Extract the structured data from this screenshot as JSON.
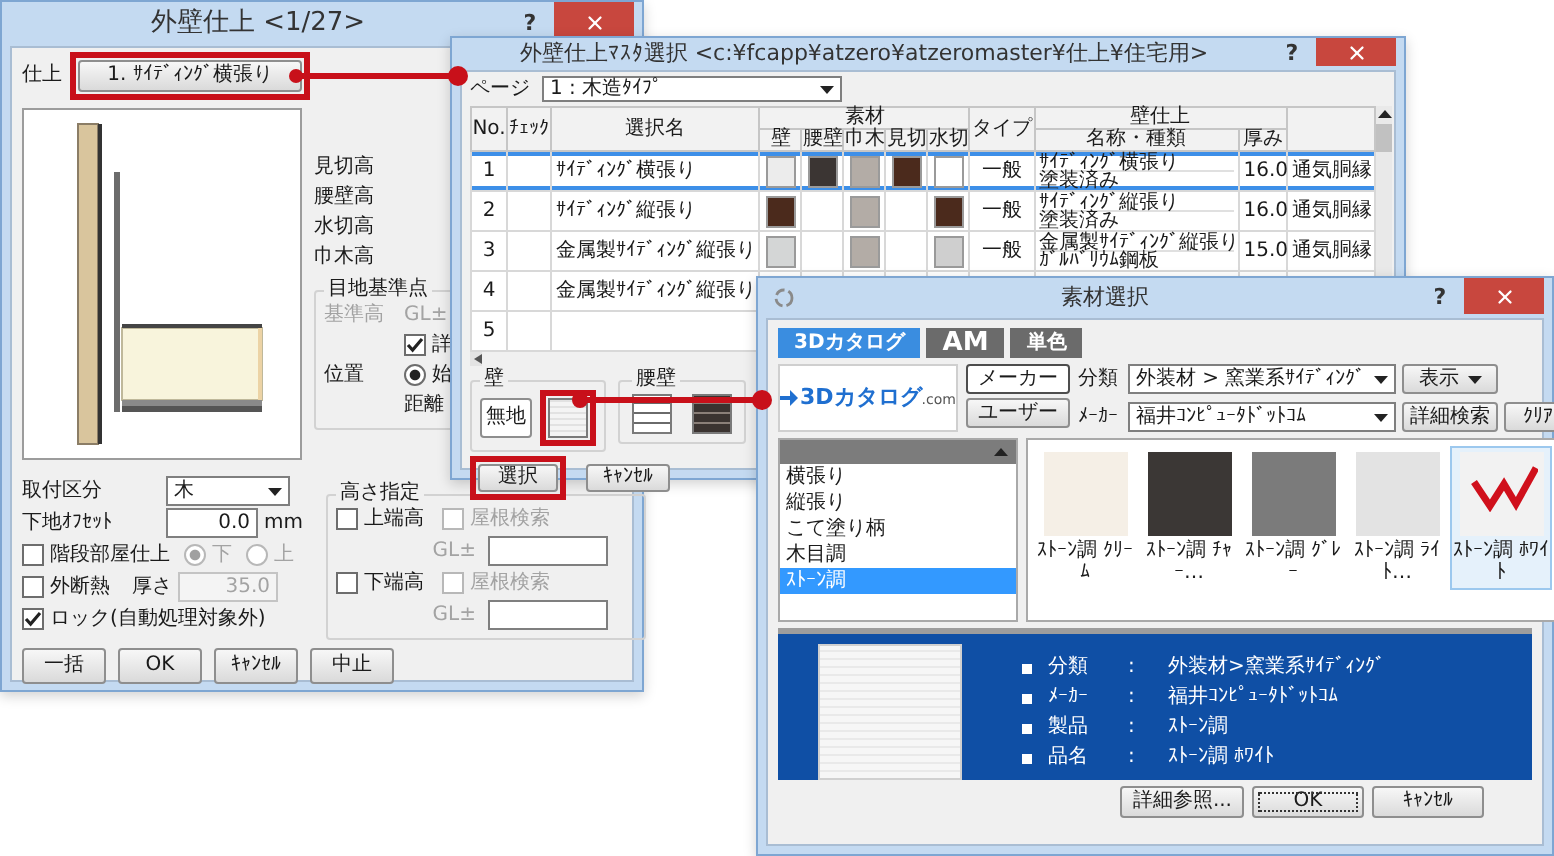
{
  "finish_window": {
    "title": "外壁仕上  <1/27>",
    "help": "?",
    "finish_label": "仕上",
    "finish_button": {
      "label": "1. ｻｲﾃﾞｨﾝｸﾞ横張り",
      "highlighted": true
    },
    "height_labels": [
      "見切高",
      "腰壁高",
      "水切高",
      "巾木高"
    ],
    "joint_group": {
      "title": "目地基準点",
      "base_height": {
        "label": "基準高",
        "unit": "GL±",
        "disabled": true
      },
      "detail": {
        "label": "詳",
        "checked": true
      },
      "position": {
        "label": "位置",
        "option": "始",
        "selected": true
      },
      "distance_label": "距離"
    },
    "mount": {
      "label": "取付区分",
      "value": "木"
    },
    "offset": {
      "label": "下地ｵﾌｾｯﾄ",
      "value": "0.0",
      "unit": "mm"
    },
    "stair": {
      "label": "階段部屋仕上",
      "checked": false,
      "disabled": true,
      "options": [
        {
          "label": "下",
          "selected": true
        },
        {
          "label": "上",
          "selected": false
        }
      ]
    },
    "insulation": {
      "label": "外断熱",
      "checked": false,
      "thickness_label": "厚さ",
      "value": "35.0",
      "disabled": true
    },
    "lock": {
      "label": "ロック(自動処理対象外)",
      "checked": true
    },
    "height_group": {
      "title": "高さ指定",
      "rows": [
        {
          "label": "上端高",
          "checked": false,
          "roof_label": "屋根検索",
          "roof_checked": false,
          "roof_disabled": true,
          "gl_label": "GL±"
        },
        {
          "label": "下端高",
          "checked": false,
          "roof_label": "屋根検索",
          "roof_checked": false,
          "roof_disabled": true,
          "gl_label": "GL±"
        }
      ]
    },
    "buttons": [
      "一括",
      "OK",
      "ｷｬﾝｾﾙ",
      "中止"
    ]
  },
  "master_window": {
    "title": "外壁仕上ﾏｽﾀ選択 <c:¥fcapp¥atzero¥atzeromaster¥仕上¥住宅用>",
    "help": "?",
    "page": {
      "label": "ページ",
      "value": "1 : 木造ﾀｲﾌﾟ"
    },
    "columns": {
      "no": "No.",
      "check": "ﾁｪｯｸ",
      "name": "選択名",
      "material": "素材",
      "materials": [
        "壁",
        "腰壁",
        "巾木",
        "見切",
        "水切"
      ],
      "type": "タイプ",
      "finish": "壁仕上",
      "finish_name": "名称・種類",
      "thickness": "厚み"
    },
    "rows": [
      {
        "no": "1",
        "selected": true,
        "name": "ｻｲﾃﾞｨﾝｸﾞ横張り",
        "swatches": {
          "wall": {
            "color": "#ececec"
          },
          "wainscot": {
            "color": "#3b3533"
          },
          "baseboard": {
            "color": "#b3aca6"
          },
          "trim": {
            "color": "#4b2a1c"
          },
          "drip": {
            "color": "#ffffff"
          }
        },
        "type": "一般",
        "finish_name": "ｻｲﾃﾞｨﾝｸﾞ横張り",
        "finish_kind": "塗装済み",
        "thickness": "16.0",
        "note": "通気胴縁"
      },
      {
        "no": "2",
        "selected": false,
        "name": "ｻｲﾃﾞｨﾝｸﾞ縦張り",
        "swatches": {
          "wall": {
            "color": "#4b2a1c"
          },
          "baseboard": {
            "color": "#b3aca6"
          },
          "drip": {
            "color": "#4b2a1c"
          }
        },
        "type": "一般",
        "finish_name": "ｻｲﾃﾞｨﾝｸﾞ縦張り",
        "finish_kind": "塗装済み",
        "thickness": "16.0",
        "note": "通気胴縁"
      },
      {
        "no": "3",
        "selected": false,
        "name": "金属製ｻｲﾃﾞｨﾝｸﾞ縦張り",
        "swatches": {
          "wall": {
            "color": "#d4d6d6"
          },
          "baseboard": {
            "color": "#b3aca6"
          },
          "drip": {
            "color": "#cfcfcf"
          }
        },
        "type": "一般",
        "finish_name": "金属製ｻｲﾃﾞｨﾝｸﾞ縦張り",
        "finish_kind": "ｶﾞﾙﾊﾞﾘｳﾑ鋼板",
        "thickness": "15.0",
        "note": "通気胴縁"
      },
      {
        "no": "4",
        "selected": false,
        "name": "金属製ｻｲﾃﾞｨﾝｸﾞ縦張り"
      },
      {
        "no": "5",
        "selected": false
      }
    ],
    "wall_group": {
      "title": "壁",
      "plain_button": "無地",
      "swatch": {
        "highlighted": true
      }
    },
    "base_group": {
      "title": "腰壁"
    },
    "select_button": {
      "label": "選択",
      "highlighted": true
    },
    "cancel_button": "ｷｬﾝｾﾙ"
  },
  "material_window": {
    "title": "素材選択",
    "help": "?",
    "tabs": [
      {
        "label": "3Dカタログ",
        "selected": true
      },
      {
        "label": "AM",
        "selected": false
      },
      {
        "label": "単色",
        "selected": false
      }
    ],
    "logo": {
      "name": "3Dカタログ",
      "suffix": ".com"
    },
    "source_buttons": [
      {
        "label": "メーカー",
        "selected": true
      },
      {
        "label": "ユーザー",
        "selected": false
      }
    ],
    "category": {
      "label": "分類",
      "value": "外装材 > 窯業系ｻｲﾃﾞｨﾝｸﾞ"
    },
    "view_button": "表示",
    "maker": {
      "label": "ﾒｰｶｰ",
      "value": "福井ｺﾝﾋﾟｭｰﾀﾄﾞｯﾄｺﾑ"
    },
    "search_button": "詳細検索",
    "clear_button": "ｸﾘｱ",
    "groups": [
      {
        "label": "横張り",
        "selected": false
      },
      {
        "label": "縦張り",
        "selected": false
      },
      {
        "label": "こて塗り柄",
        "selected": false
      },
      {
        "label": "木目調",
        "selected": false
      },
      {
        "label": "ｽﾄｰﾝ調",
        "selected": true
      }
    ],
    "products": [
      {
        "label": "ｽﾄｰﾝ調 ｸﾘｰﾑ",
        "color": "#f5efe6",
        "selected": false
      },
      {
        "label": "ｽﾄｰﾝ調 ﾁｬｰ…",
        "color": "#3b3735",
        "selected": false
      },
      {
        "label": "ｽﾄｰﾝ調 ｸﾞﾚｰ",
        "color": "#7b7b7b",
        "selected": false
      },
      {
        "label": "ｽﾄｰﾝ調 ﾗｲﾄ…",
        "color": "#e3e3e3",
        "selected": false
      },
      {
        "label": "ｽﾄｰﾝ調 ﾎﾜｲﾄ",
        "color": "#f2f2f2",
        "selected": true
      }
    ],
    "info": [
      {
        "label": "分類",
        "colon": ":",
        "value": "外装材>窯業系ｻｲﾃﾞｨﾝｸﾞ"
      },
      {
        "label": "ﾒｰｶｰ",
        "colon": ":",
        "value": "福井ｺﾝﾋﾟｭｰﾀﾄﾞｯﾄｺﾑ"
      },
      {
        "label": "製品",
        "colon": ":",
        "value": "ｽﾄｰﾝ調"
      },
      {
        "label": "品名",
        "colon": ":",
        "value": "ｽﾄｰﾝ調 ﾎﾜｲﾄ"
      }
    ],
    "buttons": [
      "詳細参照...",
      "OK",
      "ｷｬﾝｾﾙ"
    ]
  }
}
